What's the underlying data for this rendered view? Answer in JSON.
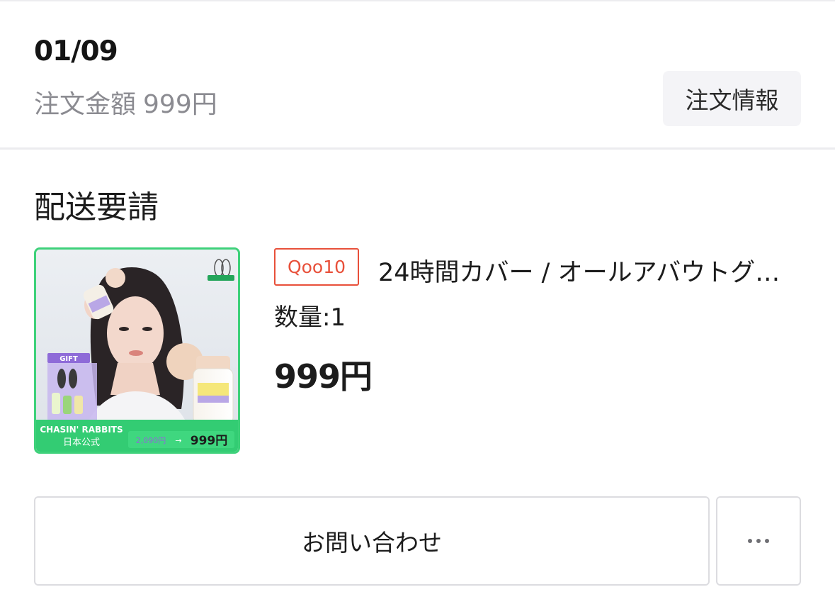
{
  "order": {
    "date": "01/09",
    "amount_label": "注文金額",
    "amount_value": "999円",
    "info_button": "注文情報"
  },
  "shipment": {
    "status": "配送要請"
  },
  "product": {
    "shop_badge": "Qoo10",
    "name": "24時間カバー / オールアバウトグロウ…",
    "quantity": "数量:1",
    "price": "999円",
    "thumbnail": {
      "brand": "CHASIN' RABBITS",
      "brand_sub": "日本公式",
      "gift": "GIFT",
      "original_price": "2,090円",
      "arrow": "→",
      "sale_price": "999円",
      "frame_color": "#3ed17a",
      "accent_purple": "#8e6bd8"
    }
  },
  "actions": {
    "contact_button": "お問い合わせ",
    "more_icon": "ellipsis-icon"
  }
}
